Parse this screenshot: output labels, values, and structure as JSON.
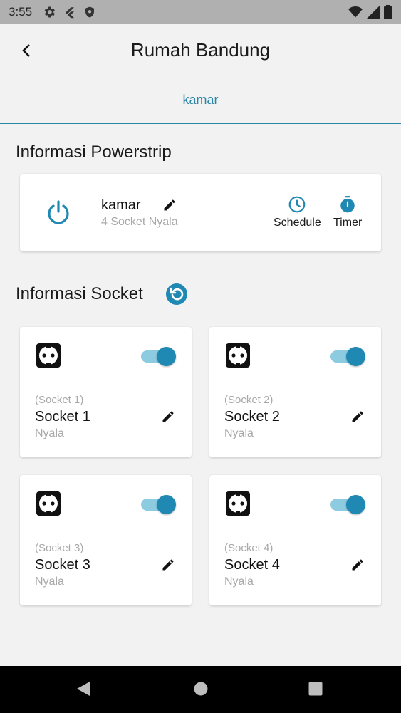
{
  "status_bar": {
    "time": "3:55",
    "left_icons": [
      "gear-icon",
      "flutter-icon",
      "shield-icon"
    ],
    "right_icons": [
      "wifi-icon",
      "signal-icon",
      "battery-icon"
    ]
  },
  "app_bar": {
    "title": "Rumah Bandung",
    "back_icon": "chevron-left-icon"
  },
  "tabs": [
    {
      "label": "kamar",
      "selected": true
    }
  ],
  "powerstrip": {
    "section_title": "Informasi Powerstrip",
    "name": "kamar",
    "subtitle": "4 Socket Nyala",
    "schedule_label": "Schedule",
    "timer_label": "Timer"
  },
  "sockets_section": {
    "title": "Informasi Socket",
    "refresh_icon": "refresh-icon"
  },
  "sockets": [
    {
      "id_label": "(Socket 1)",
      "name": "Socket 1",
      "status": "Nyala",
      "on": true
    },
    {
      "id_label": "(Socket 2)",
      "name": "Socket 2",
      "status": "Nyala",
      "on": true
    },
    {
      "id_label": "(Socket 3)",
      "name": "Socket 3",
      "status": "Nyala",
      "on": true
    },
    {
      "id_label": "(Socket 4)",
      "name": "Socket 4",
      "status": "Nyala",
      "on": true
    }
  ],
  "colors": {
    "accent": "#1f88b3",
    "accent_light": "#8ccbe0",
    "status_bar": "#b0b0b0",
    "background": "#f2f2f2"
  }
}
